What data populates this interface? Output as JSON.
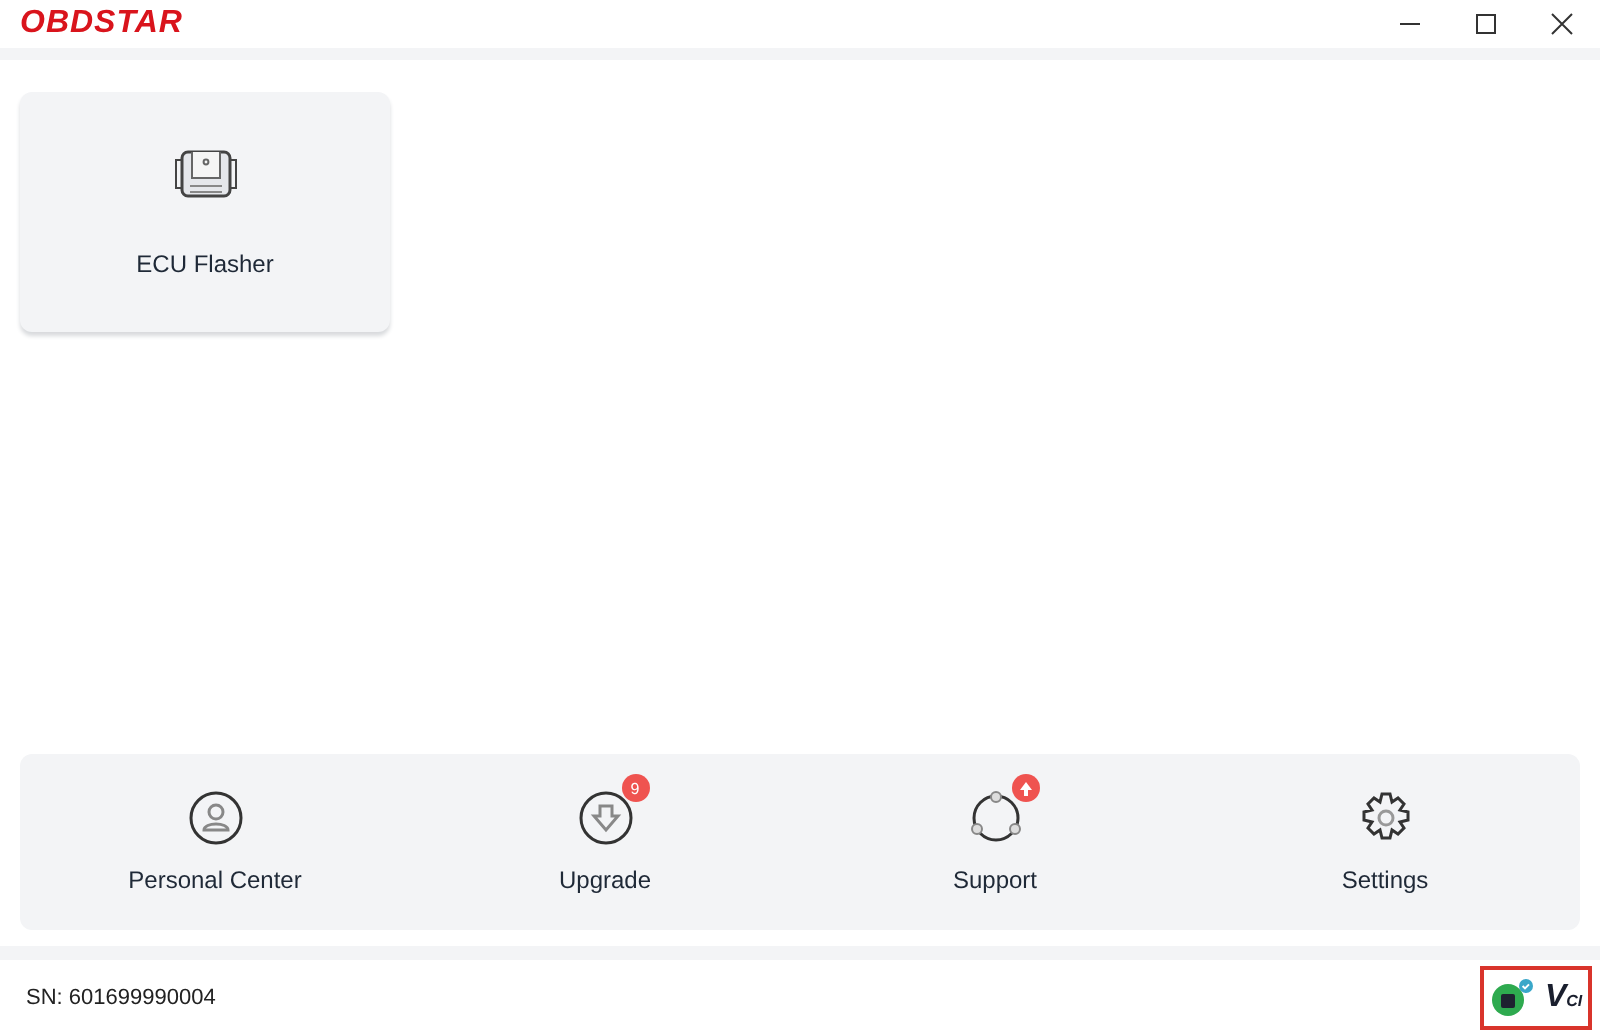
{
  "window": {
    "logo": "OBDSTAR"
  },
  "apps": [
    {
      "label": "ECU Flasher"
    }
  ],
  "nav": [
    {
      "label": "Personal Center",
      "kind": "person"
    },
    {
      "label": "Upgrade",
      "kind": "download",
      "badge": {
        "kind": "count",
        "text": "9"
      }
    },
    {
      "label": "Support",
      "kind": "share",
      "badge": {
        "kind": "alert"
      }
    },
    {
      "label": "Settings",
      "kind": "gear"
    }
  ],
  "status_bar": {
    "sn": "SN: 601699990004",
    "vci": {
      "label": "V$_{CI}$",
      "connected": true
    }
  }
}
